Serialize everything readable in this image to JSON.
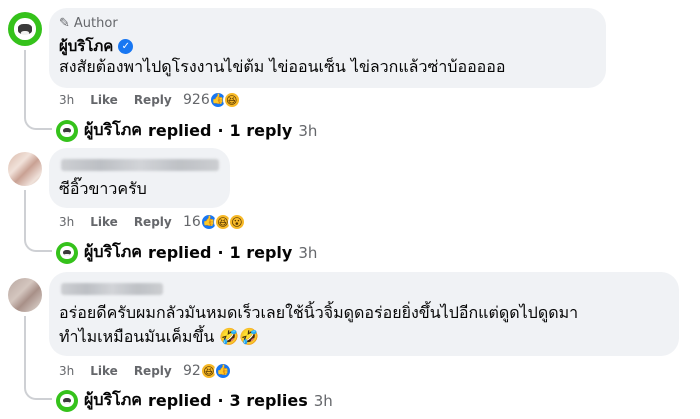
{
  "colors": {
    "accent": "#1877f2",
    "avatar_green": "#35c21b",
    "bubble": "#f0f2f5",
    "muted": "#65676b"
  },
  "comments": [
    {
      "author_tag": "Author",
      "author_tag_icon": "pencil-icon",
      "author": "ผู้บริโภค",
      "verified": true,
      "lines": [
        "สงสัยต้องพาไปดูโรงงานไข่ต้ม ไข่ออนเซ็น ไข่ลวกแล้วซ่าบ้อออออ"
      ],
      "time": "3h",
      "like": "Like",
      "reply": "Reply",
      "reaction_count": "926",
      "reactions": [
        "like",
        "haha"
      ],
      "reply_summary": {
        "author": "ผู้บริโภค",
        "label": "replied",
        "sep": "·",
        "count": "1 reply",
        "time": "3h"
      }
    },
    {
      "author": "",
      "lines": [
        "ซีอิ๊วขาวครับ"
      ],
      "time": "3h",
      "like": "Like",
      "reply": "Reply",
      "reaction_count": "16",
      "reactions": [
        "like",
        "haha",
        "wow"
      ],
      "reply_summary": {
        "author": "ผู้บริโภค",
        "label": "replied",
        "sep": "·",
        "count": "1 reply",
        "time": "3h"
      }
    },
    {
      "author": "",
      "lines": [
        "อร่อยดีครับผมกลัวมันหมดเร็วเลยใช้นิ้วจิ้มดูดอร่อยยิ่งขึ้นไปอีกแต่ดูดไปดูดมา",
        "ทำไมเหมือนมันเค็มขึ้น 🤣🤣"
      ],
      "time": "3h",
      "like": "Like",
      "reply": "Reply",
      "reaction_count": "92",
      "reactions": [
        "haha",
        "like"
      ],
      "reply_summary": {
        "author": "ผู้บริโภค",
        "label": "replied",
        "sep": "·",
        "count": "3 replies",
        "time": "3h"
      }
    }
  ]
}
